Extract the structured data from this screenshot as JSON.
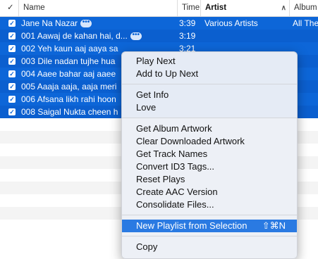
{
  "header": {
    "check_label": "✓",
    "name_label": "Name",
    "time_label": "Time",
    "artist_label": "Artist",
    "album_label": "Album",
    "sort_icon": "chevron-up-icon"
  },
  "tracks": [
    {
      "name": "Jane Na Nazar",
      "time": "3:39",
      "artist": "Various Artists",
      "album": "All The"
    },
    {
      "name": "001 Aawaj de kahan hai, d...",
      "time": "3:19",
      "artist": "",
      "album": ""
    },
    {
      "name": "002 Yeh kaun aaj aaya sa",
      "time": "3:21",
      "artist": "",
      "album": ""
    },
    {
      "name": "003 Dile nadan tujhe hua",
      "time": "",
      "artist": "",
      "album": ""
    },
    {
      "name": "004 Aaee bahar aaj aaee",
      "time": "",
      "artist": "",
      "album": ""
    },
    {
      "name": "005 Aaaja aaja, aaja meri",
      "time": "",
      "artist": "",
      "album": ""
    },
    {
      "name": "006 Afsana likh rahi hoon",
      "time": "",
      "artist": "",
      "album": ""
    },
    {
      "name": "008 Saigal Nukta cheen h",
      "time": "",
      "artist": "",
      "album": ""
    }
  ],
  "menu": {
    "items": [
      "Play Next",
      "Add to Up Next",
      "Get Info",
      "Love",
      "Get Album Artwork",
      "Clear Downloaded Artwork",
      "Get Track Names",
      "Convert ID3 Tags...",
      "Reset Plays",
      "Create AAC Version",
      "Consolidate Files...",
      "New Playlist from Selection",
      "Copy"
    ],
    "highlighted_shortcut": "⇧⌘N"
  },
  "colors": {
    "selection": "#0d66d8",
    "menu_highlight": "#2a7ae2"
  }
}
